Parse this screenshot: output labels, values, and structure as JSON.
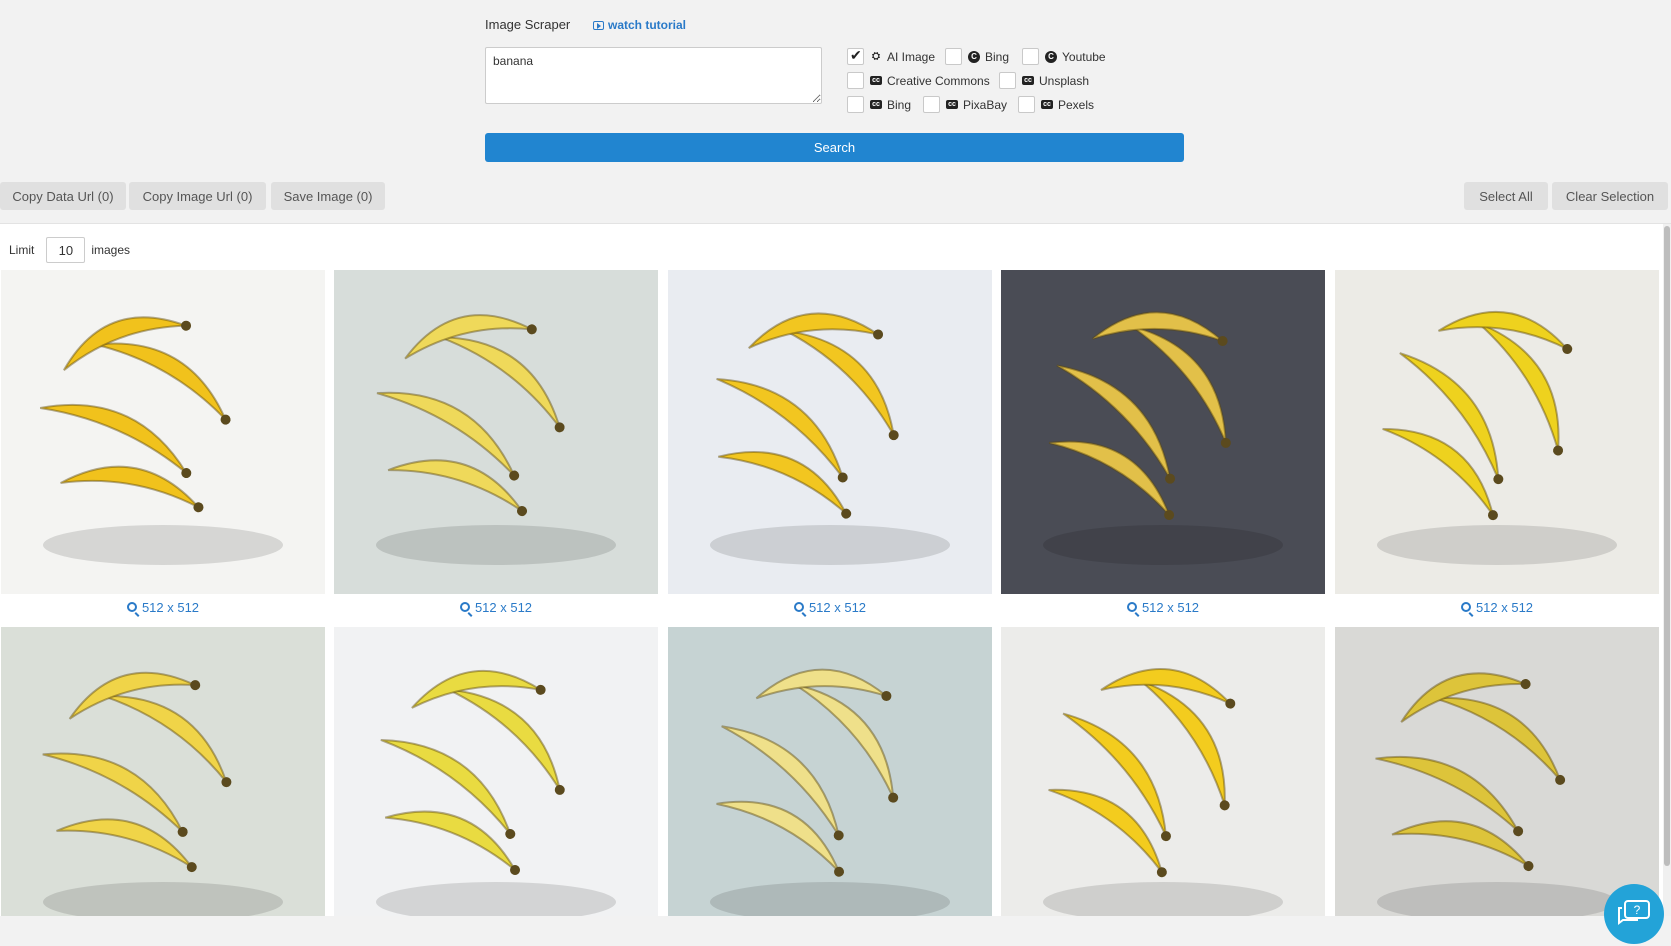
{
  "header": {
    "title": "Image Scraper",
    "tutorial_link": "watch tutorial",
    "query": "banana",
    "search_button": "Search"
  },
  "sources": [
    {
      "label": "AI Image",
      "checked": true,
      "icon": "robot-icon"
    },
    {
      "label": "Bing",
      "checked": false,
      "icon": "google-c-icon"
    },
    {
      "label": "Youtube",
      "checked": false,
      "icon": "google-c-icon"
    },
    {
      "label": "Creative Commons",
      "checked": false,
      "icon": "cc-icon"
    },
    {
      "label": "Unsplash",
      "checked": false,
      "icon": "cc-icon"
    },
    {
      "label": "Bing",
      "checked": false,
      "icon": "cc-icon"
    },
    {
      "label": "PixaBay",
      "checked": false,
      "icon": "cc-icon"
    },
    {
      "label": "Pexels",
      "checked": false,
      "icon": "cc-icon"
    }
  ],
  "toolbar": {
    "copy_data_url": "Copy Data Url (0)",
    "copy_image_url": "Copy Image Url (0)",
    "save_image": "Save Image (0)",
    "select_all": "Select All",
    "clear_selection": "Clear Selection"
  },
  "results": {
    "limit_label": "Limit",
    "limit_value": "10",
    "limit_suffix": "images",
    "images": [
      {
        "dimensions": "512 x 512",
        "bg": "#f4f4f2",
        "fruit": "#f1c21c"
      },
      {
        "dimensions": "512 x 512",
        "bg": "#d7ddda",
        "fruit": "#efd95a"
      },
      {
        "dimensions": "512 x 512",
        "bg": "#e9ecf1",
        "fruit": "#f2c620"
      },
      {
        "dimensions": "512 x 512",
        "bg": "#4a4c55",
        "fruit": "#e2c049"
      },
      {
        "dimensions": "512 x 512",
        "bg": "#ecebe6",
        "fruit": "#eed21e"
      },
      {
        "dimensions": "",
        "bg": "#dadfd8",
        "fruit": "#f0d448"
      },
      {
        "dimensions": "",
        "bg": "#f1f2f3",
        "fruit": "#e9db41"
      },
      {
        "dimensions": "",
        "bg": "#c6d3d3",
        "fruit": "#efe08a"
      },
      {
        "dimensions": "",
        "bg": "#ececea",
        "fruit": "#f3cc1e"
      },
      {
        "dimensions": "",
        "bg": "#d9d9d6",
        "fruit": "#ddc43a"
      }
    ]
  },
  "colors": {
    "accent": "#2185d0",
    "link": "#2a7ac8",
    "chat": "#23a3d8"
  }
}
